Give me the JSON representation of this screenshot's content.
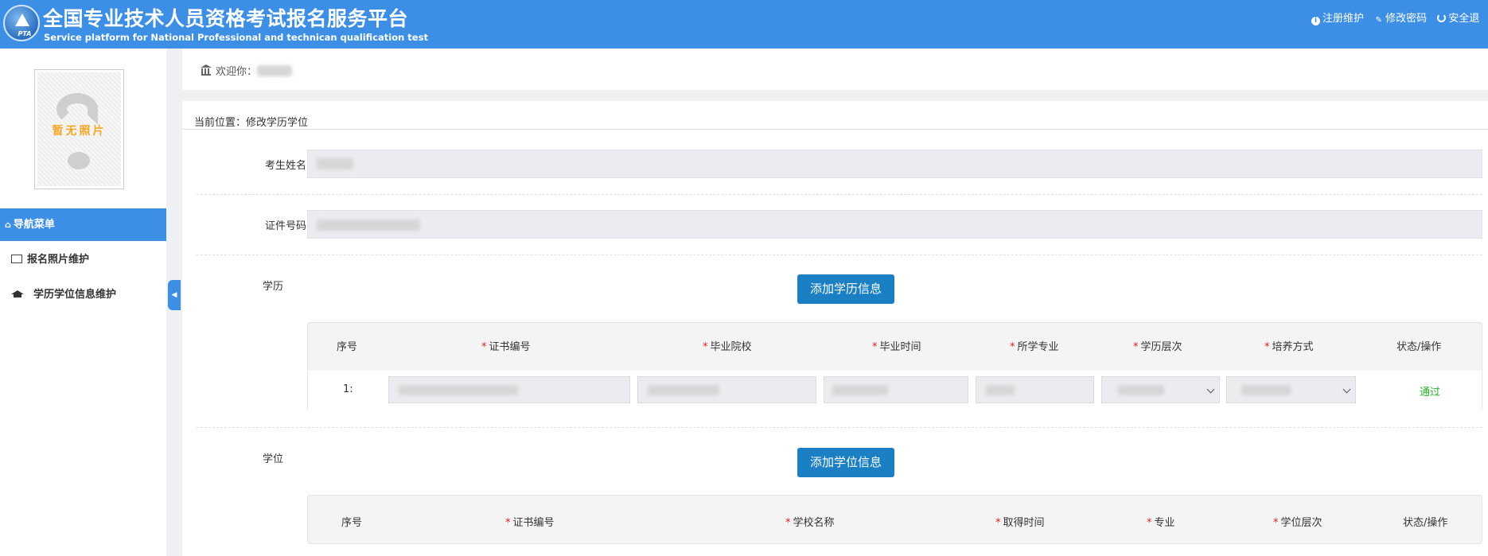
{
  "header": {
    "title_cn": "全国专业技术人员资格考试报名服务平台",
    "title_en": "Service platform for National Professional and technican qualification test",
    "logo_text": "PTA",
    "links": [
      {
        "label": "注册维护",
        "icon": "info-icon"
      },
      {
        "label": "修改密码",
        "icon": "edit-icon"
      },
      {
        "label": "安全退",
        "icon": "power-icon"
      }
    ]
  },
  "sidebar": {
    "photo_label": "暂无照片",
    "nav_title": "导航菜单",
    "items": [
      {
        "label": "报名照片维护",
        "icon": "image-icon"
      },
      {
        "label": "学历学位信息维护",
        "icon": "graduation-cap-icon"
      }
    ]
  },
  "welcome": {
    "label": "欢迎你："
  },
  "main": {
    "location": "当前位置：修改学历学位",
    "fields": {
      "name_label": "考生姓名",
      "id_label": "证件号码"
    },
    "education": {
      "label": "学历",
      "add_button": "添加学历信息",
      "headers": [
        {
          "label": "序号",
          "required": false
        },
        {
          "label": "证书编号",
          "required": true
        },
        {
          "label": "毕业院校",
          "required": true
        },
        {
          "label": "毕业时间",
          "required": true
        },
        {
          "label": "所学专业",
          "required": true
        },
        {
          "label": "学历层次",
          "required": true
        },
        {
          "label": "培养方式",
          "required": true
        },
        {
          "label": "状态/操作",
          "required": false
        }
      ],
      "rows": [
        {
          "index": "1:",
          "status": "通过"
        }
      ]
    },
    "degree": {
      "label": "学位",
      "add_button": "添加学位信息",
      "headers": [
        {
          "label": "序号",
          "required": false
        },
        {
          "label": "证书编号",
          "required": true
        },
        {
          "label": "学校名称",
          "required": true
        },
        {
          "label": "取得时间",
          "required": true
        },
        {
          "label": "专业",
          "required": true
        },
        {
          "label": "学位层次",
          "required": true
        },
        {
          "label": "状态/操作",
          "required": false
        }
      ]
    }
  },
  "colors": {
    "header_bg": "#3d8fe6",
    "button_bg": "#1b7fc4",
    "required_star": "#e02020",
    "status_pass": "#2ab52a",
    "photo_label": "#f5a623"
  }
}
